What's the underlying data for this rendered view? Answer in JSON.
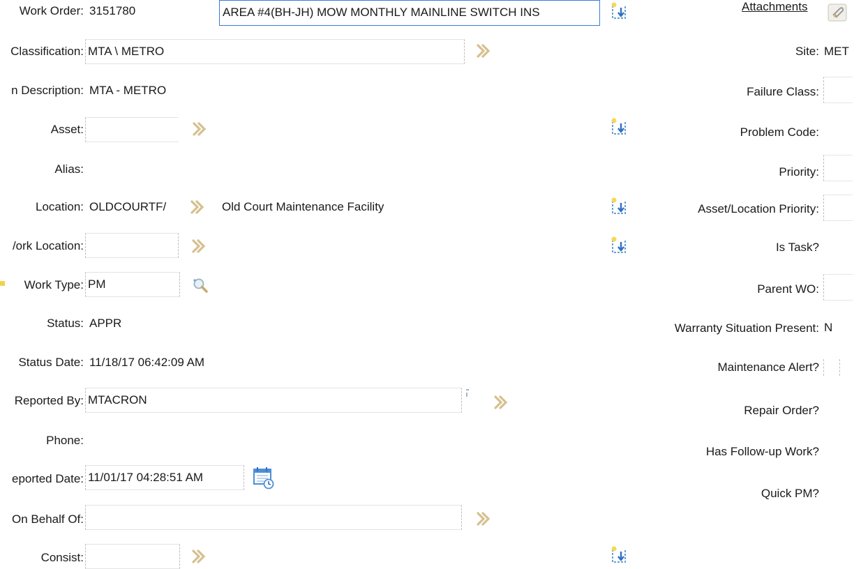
{
  "header": {
    "work_order_label": "Work Order:",
    "work_order_value": "3151780",
    "description_value": "AREA #4(BH-JH) MOW MONTHLY MAINLINE SWITCH INS",
    "attachments_label": "Attachments"
  },
  "left": {
    "classification_label": "Classification:",
    "classification_value": "MTA \\ METRO",
    "class_desc_label": "n Description:",
    "class_desc_value": "MTA - METRO",
    "asset_label": "Asset:",
    "asset_value": "",
    "alias_label": "Alias:",
    "location_label": "Location:",
    "location_value": "OLDCOURTF/",
    "location_desc": "Old Court Maintenance Facility",
    "work_location_label": "/ork Location:",
    "work_location_value": "",
    "work_type_label": "Work Type:",
    "work_type_value": "PM",
    "status_label": "Status:",
    "status_value": "APPR",
    "status_date_label": "Status Date:",
    "status_date_value": "11/18/17 06:42:09 AM",
    "reported_by_label": "Reported By:",
    "reported_by_value": "MTACRON",
    "phone_label": "Phone:",
    "reported_date_label": "eported Date:",
    "reported_date_value": "11/01/17 04:28:51 AM",
    "on_behalf_label": "On Behalf Of:",
    "on_behalf_value": "",
    "consist_label": "Consist:",
    "consist_value": ""
  },
  "right": {
    "site_label": "Site:",
    "site_value": "MET",
    "failure_class_label": "Failure Class:",
    "problem_code_label": "Problem Code:",
    "priority_label": "Priority:",
    "asset_location_priority_label": "Asset/Location Priority:",
    "is_task_label": "Is Task?",
    "parent_wo_label": "Parent WO:",
    "warranty_label": "Warranty Situation Present:",
    "warranty_value": "N",
    "maintenance_alert_label": "Maintenance Alert?",
    "repair_order_label": "Repair Order?",
    "follow_up_label": "Has Follow-up Work?",
    "quick_pm_label": "Quick PM?"
  },
  "icons": {
    "chevron": "double-chevron-right-icon",
    "long_desc": "long-description-icon",
    "attachments": "paperclip-icon",
    "lookup": "magnifier-icon",
    "calendar": "calendar-icon"
  },
  "colors": {
    "focus_border": "#3a7ad9",
    "chevron": "#d8c49a",
    "icon_blue": "#4d8fd6",
    "icon_yellow": "#f2d24a"
  }
}
